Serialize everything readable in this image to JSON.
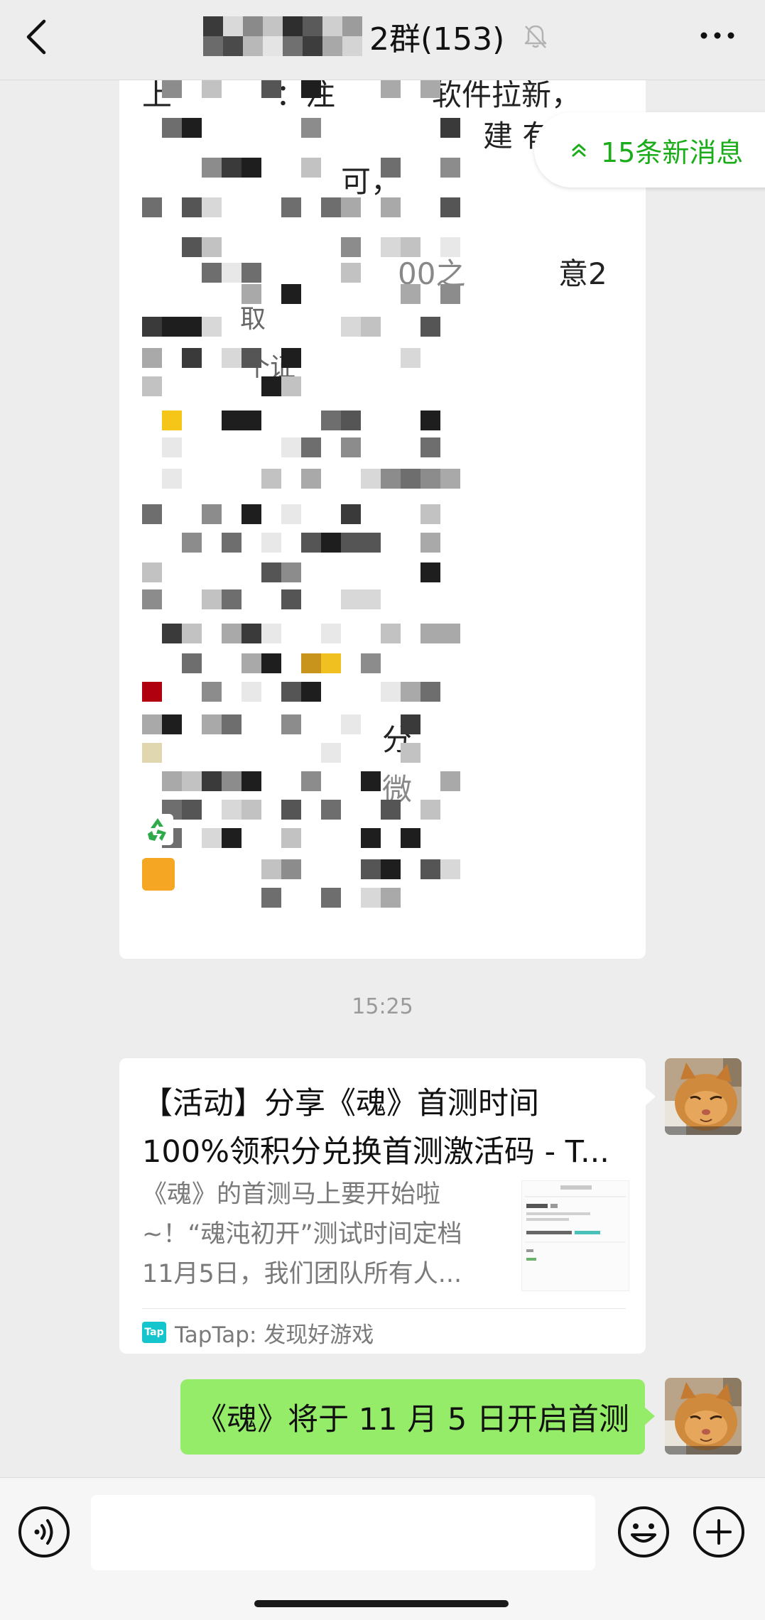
{
  "header": {
    "title": "2群(153)",
    "icons": [
      "back-icon",
      "mute-bell-icon",
      "more-icon"
    ]
  },
  "new_messages": {
    "label": "15条新消息",
    "icon": "double-chevron-up-icon",
    "color": "#1aad19"
  },
  "long_message": {
    "fragments": [
      "上",
      "：注",
      "软件拉新，",
      "建 有",
      "可，",
      "意2",
      "00之",
      "取",
      "个证",
      "分",
      "微"
    ]
  },
  "timestamp": "15:25",
  "link_card": {
    "title_line1": "【活动】分享《魂》首测时间",
    "title_line2": "100%领积分兑换首测激活码 - T...",
    "desc_line1": "《魂》的首测马上要开始啦",
    "desc_line2": "~！“魂沌初开”测试时间定档",
    "desc_line3": "11月5日，我们团队所有人...",
    "source": "TapTap: 发现好游戏",
    "source_logo": "Tap"
  },
  "sent_message": {
    "text": "《魂》将于 11 月 5 日开启首测",
    "bubble_color": "#95ec69"
  },
  "input_bar": {
    "placeholder": "",
    "icons": [
      "voice-icon",
      "emoji-icon",
      "plus-icon"
    ]
  }
}
